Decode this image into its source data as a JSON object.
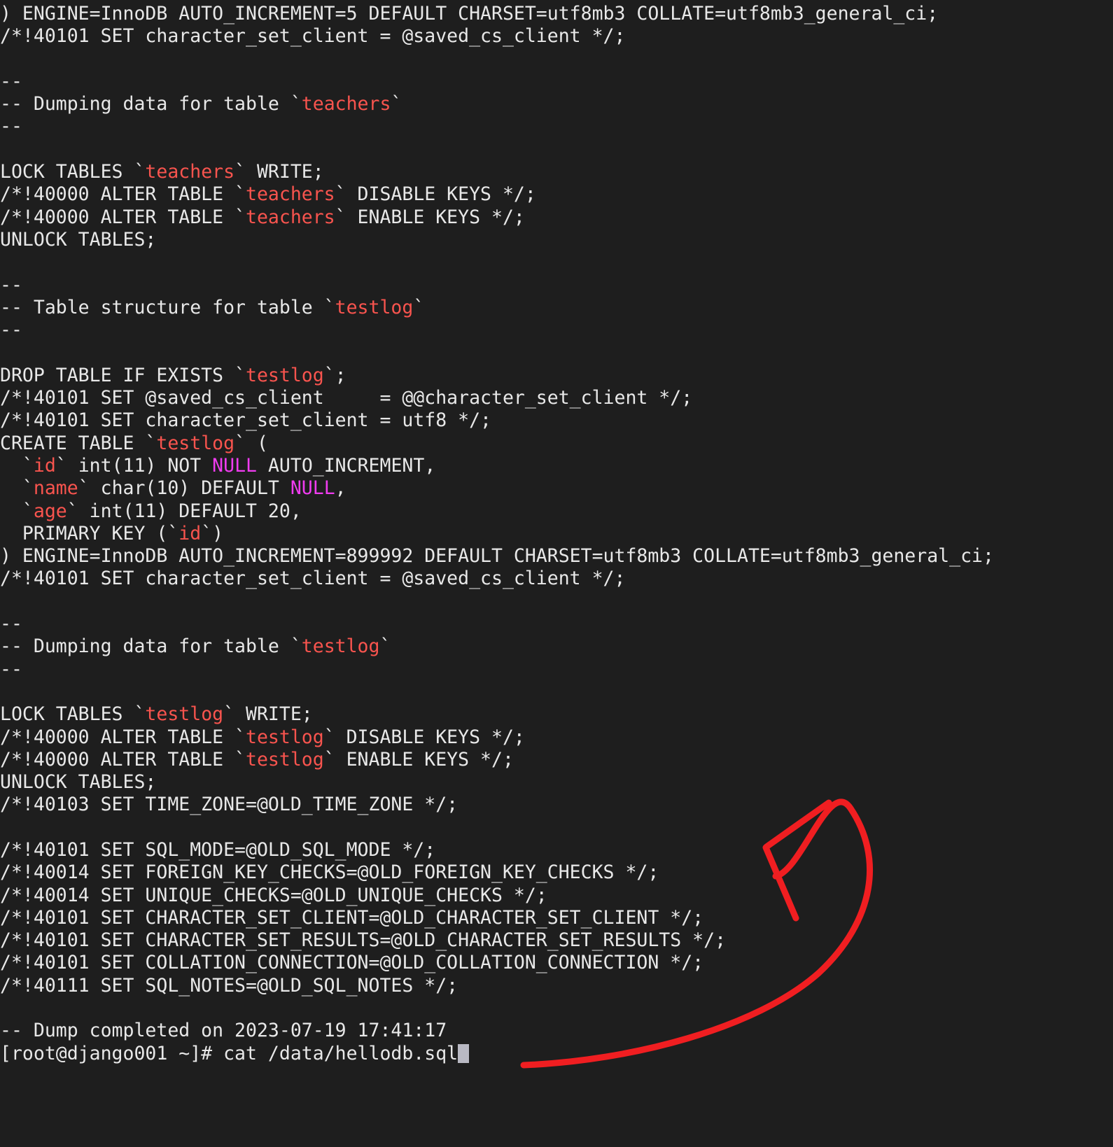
{
  "terminal": {
    "background_color": "#1e1e1e",
    "foreground_color": "#e8e8e8",
    "table_name_color": "#f8544e",
    "keyword_color": "#f03cf0",
    "cursor_color": "#b9b9c3",
    "annotation_color": "#f01e21",
    "lines": [
      {
        "id": "l01",
        "segments": [
          {
            "t": ") ENGINE=InnoDB AUTO_INCREMENT=5 DEFAULT CHARSET=utf8mb3 COLLATE=utf8mb3_general_ci;",
            "c": "plain"
          }
        ]
      },
      {
        "id": "l02",
        "segments": [
          {
            "t": "/*!40101 SET character_set_client = @saved_cs_client */;",
            "c": "plain"
          }
        ]
      },
      {
        "id": "l03",
        "segments": [
          {
            "t": "",
            "c": "plain"
          }
        ]
      },
      {
        "id": "l04",
        "segments": [
          {
            "t": "--",
            "c": "plain"
          }
        ]
      },
      {
        "id": "l05",
        "segments": [
          {
            "t": "-- Dumping data for table `",
            "c": "plain"
          },
          {
            "t": "teachers",
            "c": "tbl"
          },
          {
            "t": "`",
            "c": "plain"
          }
        ]
      },
      {
        "id": "l06",
        "segments": [
          {
            "t": "--",
            "c": "plain"
          }
        ]
      },
      {
        "id": "l07",
        "segments": [
          {
            "t": "",
            "c": "plain"
          }
        ]
      },
      {
        "id": "l08",
        "segments": [
          {
            "t": "LOCK TABLES `",
            "c": "plain"
          },
          {
            "t": "teachers",
            "c": "tbl"
          },
          {
            "t": "` WRITE;",
            "c": "plain"
          }
        ]
      },
      {
        "id": "l09",
        "segments": [
          {
            "t": "/*!40000 ALTER TABLE `",
            "c": "plain"
          },
          {
            "t": "teachers",
            "c": "tbl"
          },
          {
            "t": "` DISABLE KEYS */;",
            "c": "plain"
          }
        ]
      },
      {
        "id": "l10",
        "segments": [
          {
            "t": "/*!40000 ALTER TABLE `",
            "c": "plain"
          },
          {
            "t": "teachers",
            "c": "tbl"
          },
          {
            "t": "` ENABLE KEYS */;",
            "c": "plain"
          }
        ]
      },
      {
        "id": "l11",
        "segments": [
          {
            "t": "UNLOCK TABLES;",
            "c": "plain"
          }
        ]
      },
      {
        "id": "l12",
        "segments": [
          {
            "t": "",
            "c": "plain"
          }
        ]
      },
      {
        "id": "l13",
        "segments": [
          {
            "t": "--",
            "c": "plain"
          }
        ]
      },
      {
        "id": "l14",
        "segments": [
          {
            "t": "-- Table structure for table `",
            "c": "plain"
          },
          {
            "t": "testlog",
            "c": "tbl"
          },
          {
            "t": "`",
            "c": "plain"
          }
        ]
      },
      {
        "id": "l15",
        "segments": [
          {
            "t": "--",
            "c": "plain"
          }
        ]
      },
      {
        "id": "l16",
        "segments": [
          {
            "t": "",
            "c": "plain"
          }
        ]
      },
      {
        "id": "l17",
        "segments": [
          {
            "t": "DROP TABLE IF EXISTS `",
            "c": "plain"
          },
          {
            "t": "testlog",
            "c": "tbl"
          },
          {
            "t": "`;",
            "c": "plain"
          }
        ]
      },
      {
        "id": "l18",
        "segments": [
          {
            "t": "/*!40101 SET @saved_cs_client     = @@character_set_client */;",
            "c": "plain"
          }
        ]
      },
      {
        "id": "l19",
        "segments": [
          {
            "t": "/*!40101 SET character_set_client = utf8 */;",
            "c": "plain"
          }
        ]
      },
      {
        "id": "l20",
        "segments": [
          {
            "t": "CREATE TABLE `",
            "c": "plain"
          },
          {
            "t": "testlog",
            "c": "tbl"
          },
          {
            "t": "` (",
            "c": "plain"
          }
        ]
      },
      {
        "id": "l21",
        "segments": [
          {
            "t": "  `",
            "c": "plain"
          },
          {
            "t": "id",
            "c": "tbl"
          },
          {
            "t": "` int(11) NOT ",
            "c": "plain"
          },
          {
            "t": "NULL",
            "c": "kw"
          },
          {
            "t": " AUTO_INCREMENT,",
            "c": "plain"
          }
        ]
      },
      {
        "id": "l22",
        "segments": [
          {
            "t": "  `",
            "c": "plain"
          },
          {
            "t": "name",
            "c": "tbl"
          },
          {
            "t": "` char(10) DEFAULT ",
            "c": "plain"
          },
          {
            "t": "NULL",
            "c": "kw"
          },
          {
            "t": ",",
            "c": "plain"
          }
        ]
      },
      {
        "id": "l23",
        "segments": [
          {
            "t": "  `",
            "c": "plain"
          },
          {
            "t": "age",
            "c": "tbl"
          },
          {
            "t": "` int(11) DEFAULT 20,",
            "c": "plain"
          }
        ]
      },
      {
        "id": "l24",
        "segments": [
          {
            "t": "  PRIMARY KEY (`",
            "c": "plain"
          },
          {
            "t": "id",
            "c": "tbl"
          },
          {
            "t": "`)",
            "c": "plain"
          }
        ]
      },
      {
        "id": "l25",
        "segments": [
          {
            "t": ") ENGINE=InnoDB AUTO_INCREMENT=899992 DEFAULT CHARSET=utf8mb3 COLLATE=utf8mb3_general_ci;",
            "c": "plain"
          }
        ]
      },
      {
        "id": "l26",
        "segments": [
          {
            "t": "/*!40101 SET character_set_client = @saved_cs_client */;",
            "c": "plain"
          }
        ]
      },
      {
        "id": "l27",
        "segments": [
          {
            "t": "",
            "c": "plain"
          }
        ]
      },
      {
        "id": "l28",
        "segments": [
          {
            "t": "--",
            "c": "plain"
          }
        ]
      },
      {
        "id": "l29",
        "segments": [
          {
            "t": "-- Dumping data for table `",
            "c": "plain"
          },
          {
            "t": "testlog",
            "c": "tbl"
          },
          {
            "t": "`",
            "c": "plain"
          }
        ]
      },
      {
        "id": "l30",
        "segments": [
          {
            "t": "--",
            "c": "plain"
          }
        ]
      },
      {
        "id": "l31",
        "segments": [
          {
            "t": "",
            "c": "plain"
          }
        ]
      },
      {
        "id": "l32",
        "segments": [
          {
            "t": "LOCK TABLES `",
            "c": "plain"
          },
          {
            "t": "testlog",
            "c": "tbl"
          },
          {
            "t": "` WRITE;",
            "c": "plain"
          }
        ]
      },
      {
        "id": "l33",
        "segments": [
          {
            "t": "/*!40000 ALTER TABLE `",
            "c": "plain"
          },
          {
            "t": "testlog",
            "c": "tbl"
          },
          {
            "t": "` DISABLE KEYS */;",
            "c": "plain"
          }
        ]
      },
      {
        "id": "l34",
        "segments": [
          {
            "t": "/*!40000 ALTER TABLE `",
            "c": "plain"
          },
          {
            "t": "testlog",
            "c": "tbl"
          },
          {
            "t": "` ENABLE KEYS */;",
            "c": "plain"
          }
        ]
      },
      {
        "id": "l35",
        "segments": [
          {
            "t": "UNLOCK TABLES;",
            "c": "plain"
          }
        ]
      },
      {
        "id": "l36",
        "segments": [
          {
            "t": "/*!40103 SET TIME_ZONE=@OLD_TIME_ZONE */;",
            "c": "plain"
          }
        ]
      },
      {
        "id": "l37",
        "segments": [
          {
            "t": "",
            "c": "plain"
          }
        ]
      },
      {
        "id": "l38",
        "segments": [
          {
            "t": "/*!40101 SET SQL_MODE=@OLD_SQL_MODE */;",
            "c": "plain"
          }
        ]
      },
      {
        "id": "l39",
        "segments": [
          {
            "t": "/*!40014 SET FOREIGN_KEY_CHECKS=@OLD_FOREIGN_KEY_CHECKS */;",
            "c": "plain"
          }
        ]
      },
      {
        "id": "l40",
        "segments": [
          {
            "t": "/*!40014 SET UNIQUE_CHECKS=@OLD_UNIQUE_CHECKS */;",
            "c": "plain"
          }
        ]
      },
      {
        "id": "l41",
        "segments": [
          {
            "t": "/*!40101 SET CHARACTER_SET_CLIENT=@OLD_CHARACTER_SET_CLIENT */;",
            "c": "plain"
          }
        ]
      },
      {
        "id": "l42",
        "segments": [
          {
            "t": "/*!40101 SET CHARACTER_SET_RESULTS=@OLD_CHARACTER_SET_RESULTS */;",
            "c": "plain"
          }
        ]
      },
      {
        "id": "l43",
        "segments": [
          {
            "t": "/*!40101 SET COLLATION_CONNECTION=@OLD_COLLATION_CONNECTION */;",
            "c": "plain"
          }
        ]
      },
      {
        "id": "l44",
        "segments": [
          {
            "t": "/*!40111 SET SQL_NOTES=@OLD_SQL_NOTES */;",
            "c": "plain"
          }
        ]
      },
      {
        "id": "l45",
        "segments": [
          {
            "t": "",
            "c": "plain"
          }
        ]
      },
      {
        "id": "l46",
        "segments": [
          {
            "t": "-- Dump completed on 2023-07-19 17:41:17",
            "c": "plain"
          }
        ]
      }
    ],
    "prompt": {
      "text": "[root@django001 ~]# cat /data/hellodb.sql",
      "user": "root",
      "host": "django001",
      "cwd": "~",
      "symbol": "#",
      "command": "cat /data/hellodb.sql",
      "cursor": "block"
    },
    "annotation": {
      "type": "hand-drawn-arrow",
      "color": "#f01e21",
      "description": "red curved arrow pointing up-left toward the end of the dump output"
    }
  }
}
